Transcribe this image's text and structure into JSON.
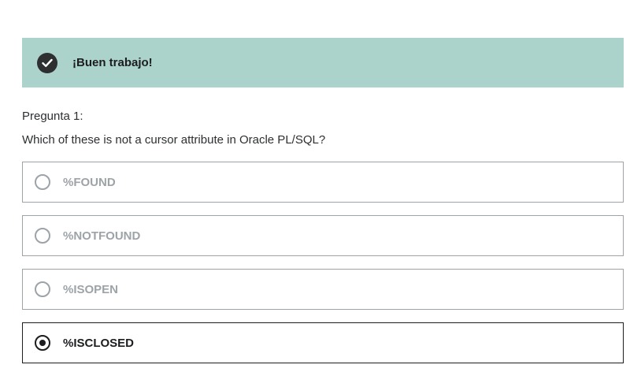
{
  "feedback": {
    "icon": "check-circle-icon",
    "message": "¡Buen trabajo!",
    "background_color": "#acd2cc"
  },
  "question": {
    "label": "Pregunta 1:",
    "text": "Which of these is not a cursor attribute in Oracle PL/SQL?"
  },
  "options": [
    {
      "label": "%FOUND",
      "selected": false
    },
    {
      "label": "%NOTFOUND",
      "selected": false
    },
    {
      "label": "%ISOPEN",
      "selected": false
    },
    {
      "label": "%ISCLOSED",
      "selected": true
    }
  ]
}
